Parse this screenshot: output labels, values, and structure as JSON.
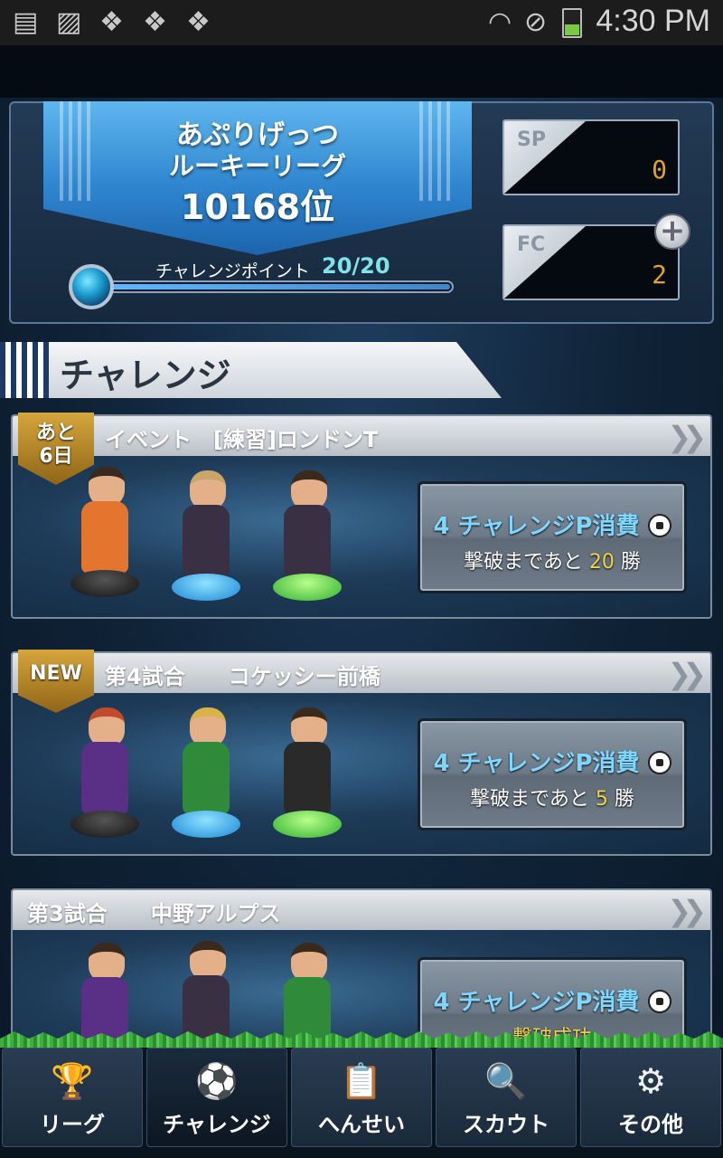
{
  "status_bar": {
    "time": "4:30 PM",
    "icons": [
      "sd-card-icon",
      "image-icon",
      "dropbox-icon",
      "dropbox-icon",
      "dropbox-icon",
      "wifi-icon",
      "no-disturb-icon",
      "battery-icon"
    ]
  },
  "header": {
    "team_name": "あぷりげっつ",
    "league": "ルーキーリーグ",
    "rank": "10168位",
    "challenge_point_label": "チャレンジポイント",
    "challenge_point_value": "20/20",
    "challenge_point_fraction": 1.0,
    "sp_label": "SP",
    "sp_value": "0",
    "fc_label": "FC",
    "fc_value": "2",
    "plus_symbol": "+"
  },
  "section_title": "チャレンジ",
  "cards": [
    {
      "badge_line1": "あと",
      "badge_line2": "6日",
      "title": "イベント　[練習]ロンドンT",
      "btn_cost": "4 チャレンジP消費",
      "btn_prefix": "撃破まであと",
      "btn_count": "20",
      "btn_suffix": "勝",
      "chevron": "❯❯"
    },
    {
      "badge_line1": "NEW",
      "title": "第4試合　　コケッシー前橋",
      "btn_cost": "4 チャレンジP消費",
      "btn_prefix": "撃破まであと",
      "btn_count": "5",
      "btn_suffix": "勝",
      "chevron": "❯❯"
    },
    {
      "title": "第3試合　　中野アルプス",
      "btn_cost": "4 チャレンジP消費",
      "btn_status": "撃破成功",
      "chevron": "❯❯"
    }
  ],
  "tabs": [
    {
      "label": "リーグ",
      "icon": "trophy-icon",
      "glyph": "🏆",
      "active": false
    },
    {
      "label": "チャレンジ",
      "icon": "soccer-ball-icon",
      "glyph": "⚽",
      "active": true
    },
    {
      "label": "へんせい",
      "icon": "clipboard-icon",
      "glyph": "📋",
      "active": false
    },
    {
      "label": "スカウト",
      "icon": "scout-icon",
      "glyph": "🔍",
      "active": false
    },
    {
      "label": "その他",
      "icon": "gear-icon",
      "glyph": "⚙",
      "active": false
    }
  ],
  "colors": {
    "accent_cyan": "#7fd6ff",
    "highlight_yellow": "#f3d34a",
    "stat_orange": "#e5a31f"
  }
}
